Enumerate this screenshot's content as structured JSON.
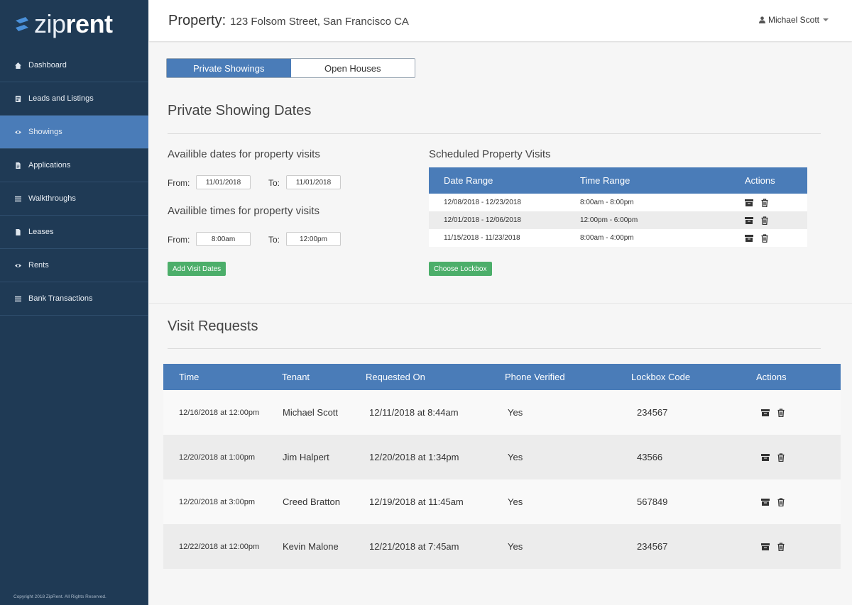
{
  "brand": {
    "logo_light": "zip",
    "logo_bold": "rent",
    "copyright": "Copyright 2018 ZipRent. All Rights Reserved."
  },
  "sidebar": {
    "items": [
      {
        "label": "Dashboard",
        "icon": "home-icon"
      },
      {
        "label": "Leads and Listings",
        "icon": "listing-icon"
      },
      {
        "label": "Showings",
        "icon": "eye-icon",
        "active": true
      },
      {
        "label": "Applications",
        "icon": "document-icon"
      },
      {
        "label": "Walkthroughs",
        "icon": "list-icon"
      },
      {
        "label": "Leases",
        "icon": "file-icon"
      },
      {
        "label": "Rents",
        "icon": "eye-icon"
      },
      {
        "label": "Bank Transactions",
        "icon": "list-icon"
      }
    ]
  },
  "header": {
    "label": "Property:",
    "address": "123 Folsom Street, San Francisco CA",
    "user": "Michael Scott"
  },
  "tabs": [
    {
      "label": "Private Showings",
      "active": true
    },
    {
      "label": "Open Houses"
    }
  ],
  "private_showing": {
    "title": "Private Showing Dates",
    "dates_title": "Availible dates for property visits",
    "times_title": "Availible times for property visits",
    "from_label": "From:",
    "to_label": "To:",
    "date_from": "11/01/2018",
    "date_to": "11/01/2018",
    "time_from": "8:00am",
    "time_to": "12:00pm",
    "add_button": "Add Visit Dates",
    "scheduled_title": "Scheduled Property Visits",
    "lockbox_button": "Choose Lockbox",
    "columns": [
      "Date Range",
      "Time Range",
      "Actions"
    ],
    "rows": [
      {
        "date_range": "12/08/2018 - 12/23/2018",
        "time_range": "8:00am - 8:00pm"
      },
      {
        "date_range": "12/01/2018 - 12/06/2018",
        "time_range": "12:00pm - 6:00pm"
      },
      {
        "date_range": "11/15/2018 - 11/23/2018",
        "time_range": "8:00am - 4:00pm"
      }
    ]
  },
  "visit_requests": {
    "title": "Visit Requests",
    "columns": [
      "Time",
      "Tenant",
      "Requested On",
      "Phone Verified",
      "Lockbox Code",
      "Actions"
    ],
    "rows": [
      {
        "time": "12/16/2018 at 12:00pm",
        "tenant": "Michael Scott",
        "requested": "12/11/2018 at 8:44am",
        "verified": "Yes",
        "code": "234567"
      },
      {
        "time": "12/20/2018 at 1:00pm",
        "tenant": "Jim Halpert",
        "requested": "12/20/2018 at 1:34pm",
        "verified": "Yes",
        "code": "43566"
      },
      {
        "time": "12/20/2018 at 3:00pm",
        "tenant": "Creed Bratton",
        "requested": "12/19/2018 at 11:45am",
        "verified": "Yes",
        "code": "567849"
      },
      {
        "time": "12/22/2018 at 12:00pm",
        "tenant": "Kevin Malone",
        "requested": "12/21/2018 at 7:45am",
        "verified": "Yes",
        "code": "234567"
      }
    ]
  }
}
